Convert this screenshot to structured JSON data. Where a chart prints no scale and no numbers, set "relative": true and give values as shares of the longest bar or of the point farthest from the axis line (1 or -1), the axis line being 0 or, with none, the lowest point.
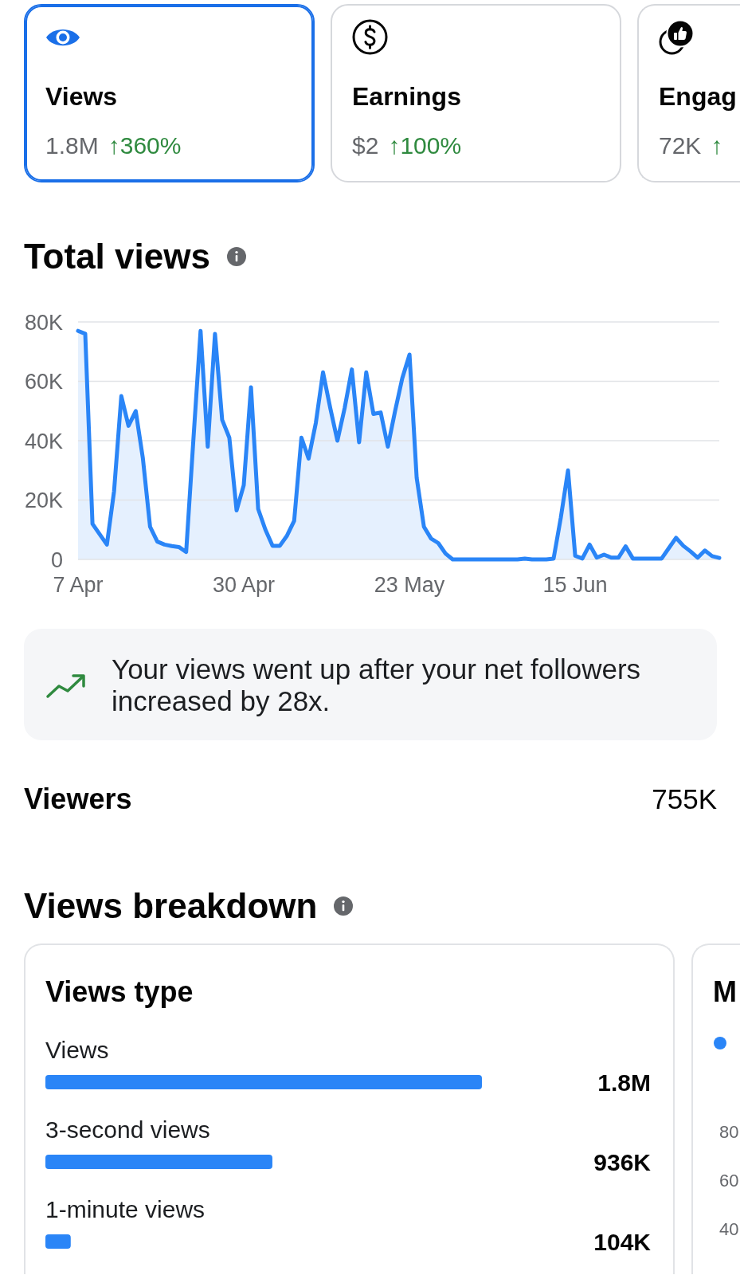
{
  "metric_cards": [
    {
      "kind": "eye",
      "title": "Views",
      "value": "1.8M",
      "change": "↑360%",
      "selected": true
    },
    {
      "kind": "coin",
      "title": "Earnings",
      "value": "$2",
      "change": "↑100%",
      "selected": false
    },
    {
      "kind": "thumb",
      "title": "Engag",
      "value": "72K",
      "change": "↑",
      "selected": false
    }
  ],
  "total_views": {
    "title": "Total views",
    "chart_data": {
      "type": "area",
      "grid": true,
      "categories": [
        "7 Apr",
        null,
        null,
        null,
        null,
        null,
        null,
        null,
        null,
        null,
        null,
        null,
        null,
        null,
        null,
        null,
        null,
        null,
        null,
        null,
        null,
        null,
        null,
        "30 Apr",
        null,
        null,
        null,
        null,
        null,
        null,
        null,
        null,
        null,
        null,
        null,
        null,
        null,
        null,
        null,
        null,
        null,
        null,
        null,
        null,
        null,
        null,
        "23 May",
        null,
        null,
        null,
        null,
        null,
        null,
        null,
        null,
        null,
        null,
        null,
        null,
        null,
        null,
        null,
        null,
        null,
        null,
        null,
        null,
        null,
        null,
        "15 Jun",
        null,
        null,
        null,
        null,
        null,
        null,
        null,
        null,
        null,
        null,
        null,
        null,
        null,
        null,
        null,
        null,
        null,
        null,
        null,
        null
      ],
      "ylim": [
        0,
        80000
      ],
      "yticks": [
        {
          "value": 0,
          "label": "0"
        },
        {
          "value": 20000,
          "label": "20K"
        },
        {
          "value": 40000,
          "label": "40K"
        },
        {
          "value": 60000,
          "label": "60K"
        },
        {
          "value": 80000,
          "label": "80K"
        }
      ],
      "series": [
        {
          "color": "#2a85f7",
          "values": [
            77000,
            76000,
            12000,
            8500,
            5000,
            23000,
            55000,
            45000,
            50000,
            34000,
            11000,
            6000,
            5000,
            4500,
            4200,
            2500,
            40000,
            77000,
            38000,
            76000,
            47000,
            41000,
            16500,
            25000,
            58000,
            17000,
            10000,
            4600,
            4600,
            8000,
            13000,
            41000,
            34000,
            46000,
            63000,
            51000,
            40000,
            51000,
            64000,
            39500,
            63000,
            49000,
            49500,
            38000,
            50000,
            61000,
            69000,
            27500,
            11000,
            7000,
            5500,
            2000,
            0,
            0,
            0,
            0,
            0,
            0,
            0,
            0,
            0,
            0,
            300,
            0,
            0,
            0,
            300,
            14000,
            30000,
            1200,
            300,
            5000,
            600,
            1600,
            600,
            600,
            4400,
            300,
            300,
            300,
            300,
            300,
            3800,
            7300,
            4600,
            2700,
            600,
            3000,
            1100,
            500
          ]
        }
      ]
    }
  },
  "insight": {
    "text": "Your views went up after your net followers increased by 28x."
  },
  "viewers": {
    "label": "Viewers",
    "value": "755K"
  },
  "views_breakdown": {
    "title": "Views breakdown",
    "cards": [
      {
        "kind": "bars",
        "title": "Views type",
        "chart_data": {
          "type": "bar",
          "orientation": "horizontal",
          "relative": true,
          "categories": [
            "Views",
            "3-second views",
            "1-minute views"
          ],
          "series": [
            {
              "color": "#2a85f7",
              "values": [
                1,
                0.52,
                0.058
              ]
            }
          ],
          "value_labels": [
            "1.8M",
            "936K",
            "104K"
          ]
        }
      },
      {
        "kind": "chart",
        "title": "M",
        "legend": [
          {
            "color": "#2a85f7"
          }
        ],
        "y_axis_labels": [
          "80",
          "60",
          "40"
        ]
      }
    ]
  }
}
